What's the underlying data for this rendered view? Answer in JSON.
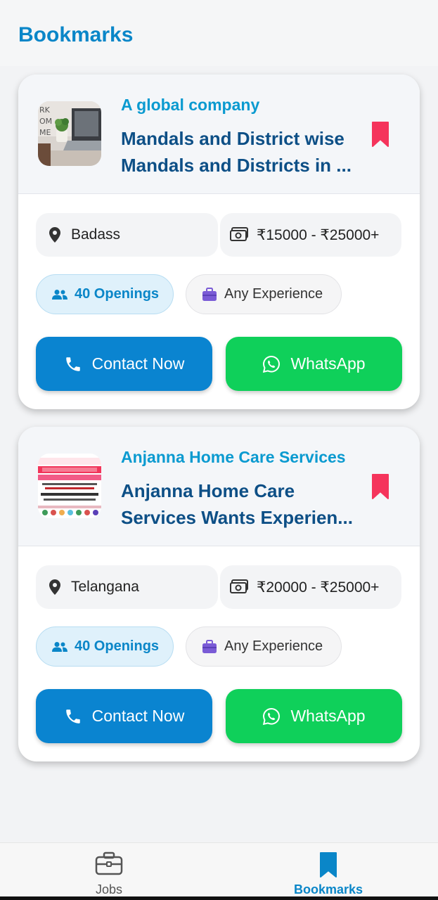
{
  "header": {
    "title": "Bookmarks"
  },
  "jobs": [
    {
      "company": "A global company",
      "title_line1": "Mandals and District wise",
      "title_line2": "Mandals and Districts in ...",
      "location": "Badass",
      "salary": "₹15000 - ₹25000+",
      "openings": "40 Openings",
      "experience": "Any Experience",
      "contact_label": "Contact Now",
      "whatsapp_label": "WhatsApp"
    },
    {
      "company": "Anjanna Home Care Services",
      "title_line1": "Anjanna Home Care",
      "title_line2": "Services Wants Experien...",
      "location": "Telangana",
      "salary": "₹20000 - ₹25000+",
      "openings": "40 Openings",
      "experience": "Any Experience",
      "contact_label": "Contact Now",
      "whatsapp_label": "WhatsApp"
    }
  ],
  "bottom_nav": {
    "jobs_label": "Jobs",
    "bookmarks_label": "Bookmarks"
  },
  "colors": {
    "accent": "#0a86c8",
    "bookmark": "#f5345c",
    "whatsapp": "#0fd05a",
    "contact": "#0a84d0"
  },
  "icons": [
    "bookmark-icon",
    "location-pin-icon",
    "money-icon",
    "people-icon",
    "briefcase-icon",
    "phone-icon",
    "whatsapp-icon"
  ]
}
